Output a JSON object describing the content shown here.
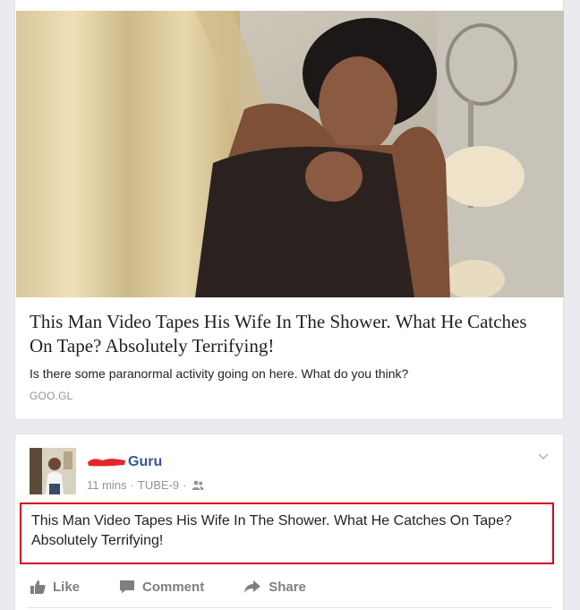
{
  "link_preview": {
    "title": "This Man Video Tapes His Wife In The Shower. What He Catches On Tape? Absolutely Terrifying!",
    "description": "Is there some paranormal activity going on here. What do you think?",
    "domain": "GOO.GL"
  },
  "post": {
    "author_name": "Guru",
    "timestamp": "11 mins",
    "separator": "·",
    "group": "TUBE-9",
    "audience_icon": "friends-icon",
    "text": "This Man Video Tapes His Wife In The Shower. What He Catches On Tape? Absolutely Terrifying!"
  },
  "actions": {
    "like_label": "Like",
    "comment_label": "Comment",
    "share_label": "Share"
  },
  "colors": {
    "link_blue": "#365899",
    "highlight_red": "#d3001b",
    "meta_gray": "#90949c",
    "background": "#e9ebee"
  }
}
